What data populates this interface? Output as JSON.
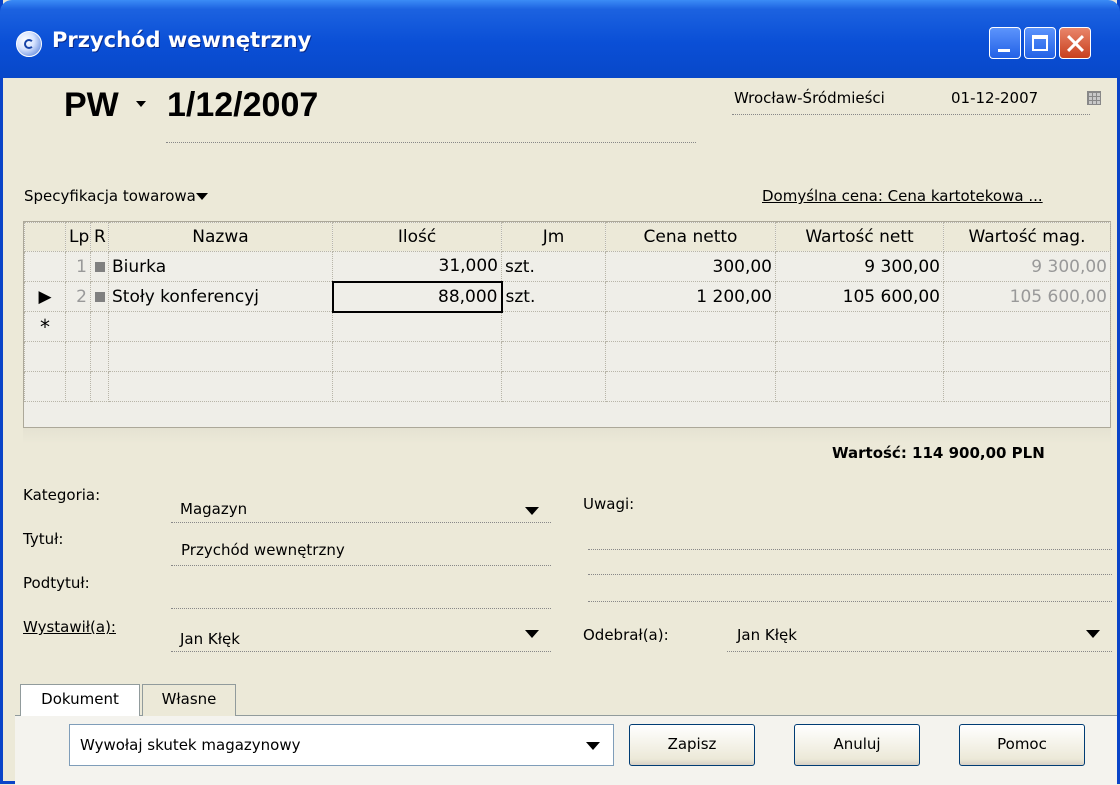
{
  "window": {
    "title": "Przychód wewnętrzny"
  },
  "header": {
    "doc_prefix": "PW",
    "doc_number": "1/12/2007",
    "location": "Wrocław-Śródmieści",
    "date": "01-12-2007"
  },
  "specification": {
    "label": "Specyfikacja towarowa",
    "default_price": "Domyślna cena: Cena kartotekowa ..."
  },
  "grid": {
    "columns": [
      "Lp",
      "R",
      "Nazwa",
      "Ilość",
      "Jm",
      "Cena netto",
      "Wartość nett",
      "Wartość mag."
    ],
    "rows": [
      {
        "lp": "1",
        "nazwa": "Biurka",
        "ilosc": "31,000",
        "jm": "szt.",
        "cena": "300,00",
        "wartosc_netto": "9 300,00",
        "wartosc_mag": "9 300,00"
      },
      {
        "lp": "2",
        "nazwa": "Stoły konferencyj",
        "ilosc": "88,000",
        "jm": "szt.",
        "cena": "1 200,00",
        "wartosc_netto": "105 600,00",
        "wartosc_mag": "105 600,00"
      }
    ],
    "new_row_marker": "*"
  },
  "total": "Wartość: 114 900,00 PLN",
  "form": {
    "kategoria_label": "Kategoria:",
    "kategoria_value": "Magazyn",
    "tytul_label": "Tytuł:",
    "tytul_value": "Przychód wewnętrzny",
    "podtytul_label": "Podtytuł:",
    "wystawil_label": "Wystawił(a):",
    "wystawil_value": "Jan Kłęk",
    "uwagi_label": "Uwagi:",
    "odebral_label": "Odebrał(a):",
    "odebral_value": "Jan Kłęk"
  },
  "tabs": [
    "Dokument",
    "Własne"
  ],
  "footer": {
    "action_select": "Wywołaj skutek magazynowy",
    "save": "Zapisz",
    "cancel": "Anuluj",
    "help": "Pomoc"
  }
}
